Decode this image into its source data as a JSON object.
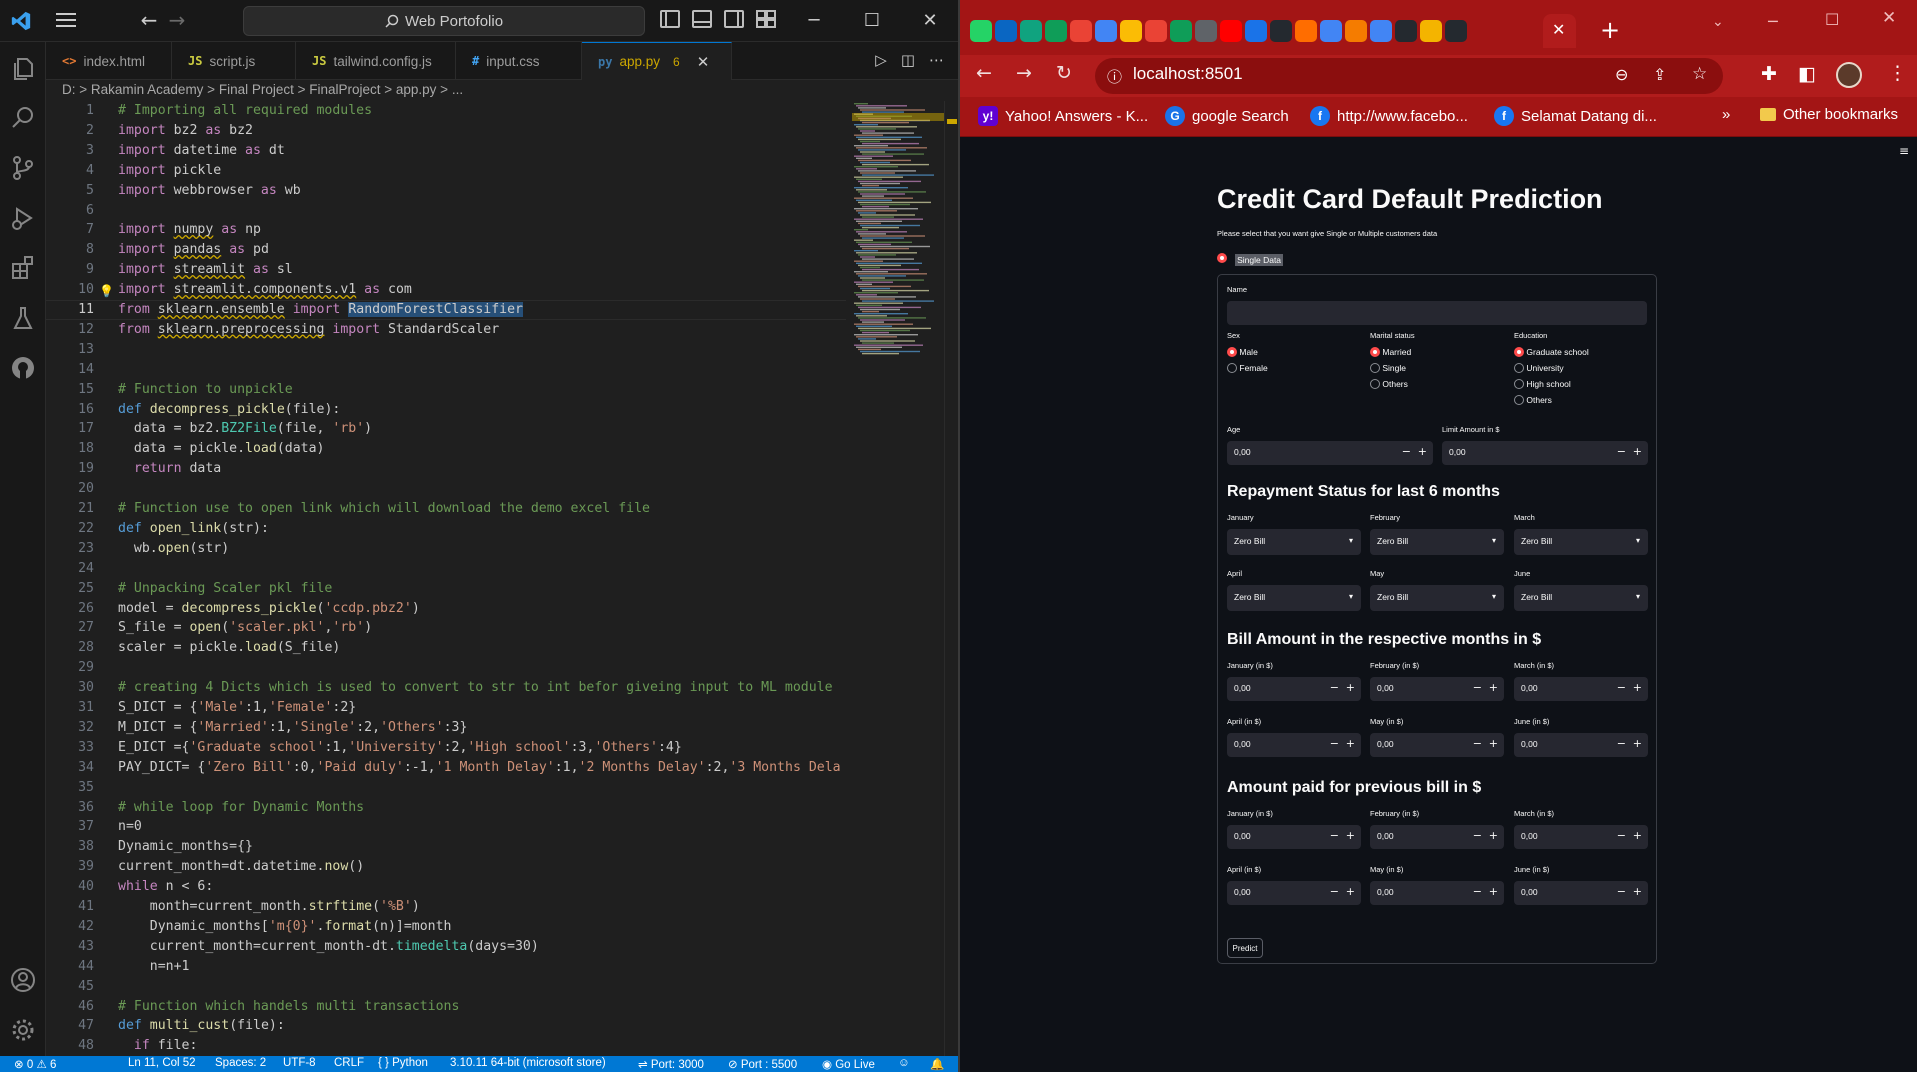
{
  "vscode": {
    "search_text": "Web Portofolio",
    "tabs": [
      {
        "icon": "<>",
        "label": "index.html"
      },
      {
        "icon": "JS",
        "label": "script.js"
      },
      {
        "icon": "JS",
        "label": "tailwind.config.js"
      },
      {
        "icon": "#",
        "label": "input.css"
      },
      {
        "icon": "py",
        "label": "app.py",
        "modified": "6"
      }
    ],
    "breadcrumb": "D: > Rakamin Academy > Final Project > FinalProject > app.py > ...",
    "status": {
      "errors": "0",
      "warnings": "6",
      "position": "Ln 11, Col 52",
      "spaces": "Spaces: 2",
      "encoding": "UTF-8",
      "eol": "CRLF",
      "language": "Python",
      "interpreter": "3.10.11 64-bit (microsoft store)",
      "port1": "Port: 3000",
      "port2": "Port : 5500",
      "golive": "Go Live"
    },
    "code_lines": [
      "<span class='cm'># Importing all required modules</span>",
      "<span class='kw'>import</span> bz2 <span class='kw'>as</span> bz2",
      "<span class='kw'>import</span> datetime <span class='kw'>as</span> dt",
      "<span class='kw'>import</span> pickle",
      "<span class='kw'>import</span> webbrowser <span class='kw'>as</span> wb",
      "",
      "<span class='kw'>import</span> <span class='sq'>numpy</span> <span class='kw'>as</span> np",
      "<span class='kw'>import</span> <span class='sq'>pandas</span> <span class='kw'>as</span> pd",
      "<span class='kw'>import</span> <span class='sq'>streamlit</span> <span class='kw'>as</span> sl",
      "<span class='kw'>import</span> <span class='sq'>streamlit.components.v1</span> <span class='kw'>as</span> com",
      "<span class='kw'>from</span> <span class='sq'>sklearn.ensemble</span> <span class='kw'>import</span> <span class='hl'>RandomForestClassifier</span>",
      "<span class='kw'>from</span> <span class='sq'>sklearn.preprocessing</span> <span class='kw'>import</span> StandardScaler",
      "",
      "",
      "<span class='cm'># Function to unpickle</span>",
      "<span class='kwb'>def</span> <span class='fn'>decompress_pickle</span>(file):",
      "  data = bz2.<span class='cl'>BZ2File</span>(file, <span class='st'>'rb'</span>)",
      "  data = pickle.<span class='fn'>load</span>(data)",
      "  <span class='kw'>return</span> data",
      "",
      "<span class='cm'># Function use to open link which will download the demo excel file</span>",
      "<span class='kwb'>def</span> <span class='fn'>open_link</span>(str):",
      "  wb.<span class='fn'>open</span>(str)",
      "",
      "<span class='cm'># Unpacking Scaler pkl file</span>",
      "model = <span class='fn'>decompress_pickle</span>(<span class='st'>'ccdp.pbz2'</span>)",
      "S_file = <span class='fn'>open</span>(<span class='st'>'scaler.pkl'</span>,<span class='st'>'rb'</span>)",
      "scaler = pickle.<span class='fn'>load</span>(S_file)",
      "",
      "<span class='cm'># creating 4 Dicts which is used to convert to str to int befor giveing input to ML module</span>",
      "S_DICT = {<span class='st'>'Male'</span>:1,<span class='st'>'Female'</span>:2}",
      "M_DICT = {<span class='st'>'Married'</span>:1,<span class='st'>'Single'</span>:2,<span class='st'>'Others'</span>:3}",
      "E_DICT ={<span class='st'>'Graduate school'</span>:1,<span class='st'>'University'</span>:2,<span class='st'>'High school'</span>:3,<span class='st'>'Others'</span>:4}",
      "PAY_DICT= {<span class='st'>'Zero Bill'</span>:0,<span class='st'>'Paid duly'</span>:-1,<span class='st'>'1 Month Delay'</span>:1,<span class='st'>'2 Months Delay'</span>:2,<span class='st'>'3 Months Dela</span>",
      "",
      "<span class='cm'># while loop for Dynamic Months</span>",
      "n=0",
      "Dynamic_months={}",
      "current_month=dt.datetime.<span class='fn'>now</span>()",
      "<span class='kw'>while</span> n &lt; 6:",
      "    month=current_month.<span class='fn'>strftime</span>(<span class='st'>'%B'</span>)",
      "    Dynamic_months[<span class='st'>'m{0}'</span>.<span class='fn'>format</span>(n)]=month",
      "    current_month=current_month-dt.<span class='cl'>timedelta</span>(days=30)",
      "    n=n+1",
      "",
      "<span class='cm'># Function which handels multi transactions</span>",
      "<span class='kwb'>def</span> <span class='fn'>multi_cust</span>(file):",
      "  <span class='kw'>if</span> file:"
    ]
  },
  "browser": {
    "url": "localhost:8501",
    "bookmarks": [
      {
        "label": "Yahoo! Answers - K...",
        "icon": "y!",
        "color": "#6001d2"
      },
      {
        "label": "google Search",
        "icon": "G",
        "color": "#1a73e8"
      },
      {
        "label": "http://www.facebo...",
        "icon": "f",
        "color": "#1877f2"
      },
      {
        "label": "Selamat Datang di...",
        "icon": "f",
        "color": "#1877f2"
      }
    ],
    "more_bookmarks": "»",
    "other_bookmarks": "Other bookmarks",
    "tab_favicons": [
      "#25d366",
      "#0a66c2",
      "#10a37f",
      "#0f9d58",
      "#ea4335",
      "#4285f4",
      "#fbbc05",
      "#ea4335",
      "#0f9d58",
      "#5f6368",
      "#ff0000",
      "#1a73e8",
      "#24292f",
      "#ff6d00",
      "#4285f4",
      "#f57c00",
      "#4285f4",
      "#24292f",
      "#f4b400",
      "#24292f"
    ]
  },
  "app": {
    "title": "Credit Card Default Prediction",
    "subtitle": "Please select that you want give Single or Multiple customers data",
    "data_mode": "Single Data",
    "name_label": "Name",
    "sex_label": "Sex",
    "sex_options": [
      "Male",
      "Female"
    ],
    "marital_label": "Marital status",
    "marital_options": [
      "Married",
      "Single",
      "Others"
    ],
    "education_label": "Education",
    "education_options": [
      "Graduate school",
      "University",
      "High school",
      "Others"
    ],
    "age_label": "Age",
    "age_value": "0,00",
    "limit_label": "Limit Amount in $",
    "limit_value": "0,00",
    "repayment_title": "Repayment Status for last 6 months",
    "months": [
      "January",
      "February",
      "March",
      "April",
      "May",
      "June"
    ],
    "repayment_value": "Zero Bill",
    "bill_title": "Bill Amount in the respective months in $",
    "month_in": [
      "January (in $)",
      "February (in $)",
      "March (in $)",
      "April (in $)",
      "May (in $)",
      "June (in $)"
    ],
    "amount_value": "0,00",
    "paid_title": "Amount paid for previous bill in $",
    "predict_label": "Predict"
  }
}
